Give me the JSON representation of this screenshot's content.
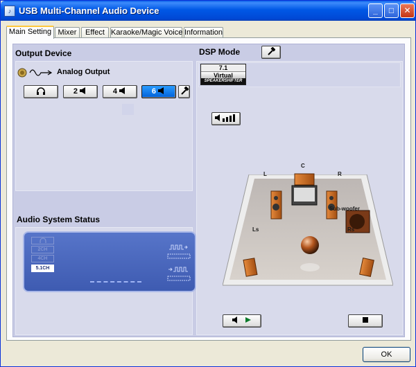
{
  "window": {
    "title": "USB Multi-Channel Audio Device",
    "minimize_glyph": "_",
    "maximize_glyph": "□",
    "close_glyph": "✕"
  },
  "tabs": [
    {
      "label": "Main Setting",
      "active": true
    },
    {
      "label": "Mixer",
      "active": false
    },
    {
      "label": "Effect",
      "active": false
    },
    {
      "label": "Karaoke/Magic Voice",
      "active": false
    },
    {
      "label": "Information",
      "active": false
    }
  ],
  "output_device": {
    "heading": "Output Device",
    "source_label": "Analog Output",
    "buttons": [
      {
        "label": "",
        "icon": "headphone-icon",
        "selected": false
      },
      {
        "label": "2",
        "icon": "speaker-icon",
        "selected": false
      },
      {
        "label": "4",
        "icon": "speaker-icon",
        "selected": false
      },
      {
        "label": "6",
        "icon": "speaker-icon",
        "selected": true
      }
    ]
  },
  "dsp_mode": {
    "heading": "DSP Mode",
    "badge_top": "7.1",
    "badge_middle": "Virtual",
    "badge_bottom": "SPEAKERSHIFTER"
  },
  "speakers": {
    "left": "L",
    "center": "C",
    "right": "R",
    "subwoofer": "Sub-woofer",
    "left_surround": "Ls",
    "right_surround": "Rs"
  },
  "audio_status": {
    "heading": "Audio System Status",
    "channels": [
      "2CH",
      "4CH",
      "5.1CH"
    ],
    "active_channel": "5.1CH"
  },
  "footer": {
    "ok_label": "OK"
  },
  "colors": {
    "titlebar": "#0058E6",
    "selected_button": "#0060D8",
    "panel_bg": "#C9CCE5",
    "status_box": "#4A67BD"
  }
}
